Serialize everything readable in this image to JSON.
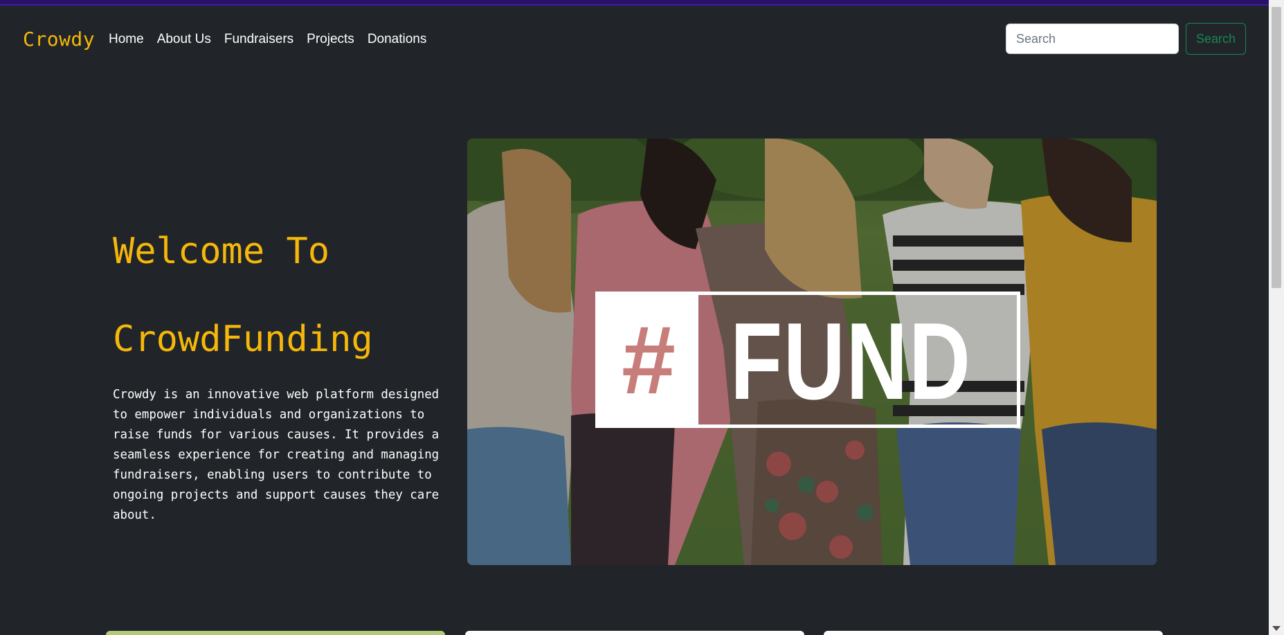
{
  "nav": {
    "brand": "Crowdy",
    "links": [
      "Home",
      "About Us",
      "Fundraisers",
      "Projects",
      "Donations"
    ],
    "search_placeholder": "Search",
    "search_button": "Search"
  },
  "hero": {
    "title_line1": "Welcome To",
    "title_line2": "CrowdFunding",
    "description": "Crowdy is an innovative web platform designed to empower individuals and organizations to raise funds for various causes. It provides a seamless experience for creating and managing fundraisers, enabling users to contribute to ongoing projects and support causes they care about.",
    "image": {
      "hash_text": "#",
      "fund_text": "FUND"
    }
  },
  "colors": {
    "accent": "#f5b70a",
    "background": "#212529",
    "success": "#198754",
    "topbar": "#2a1169"
  }
}
